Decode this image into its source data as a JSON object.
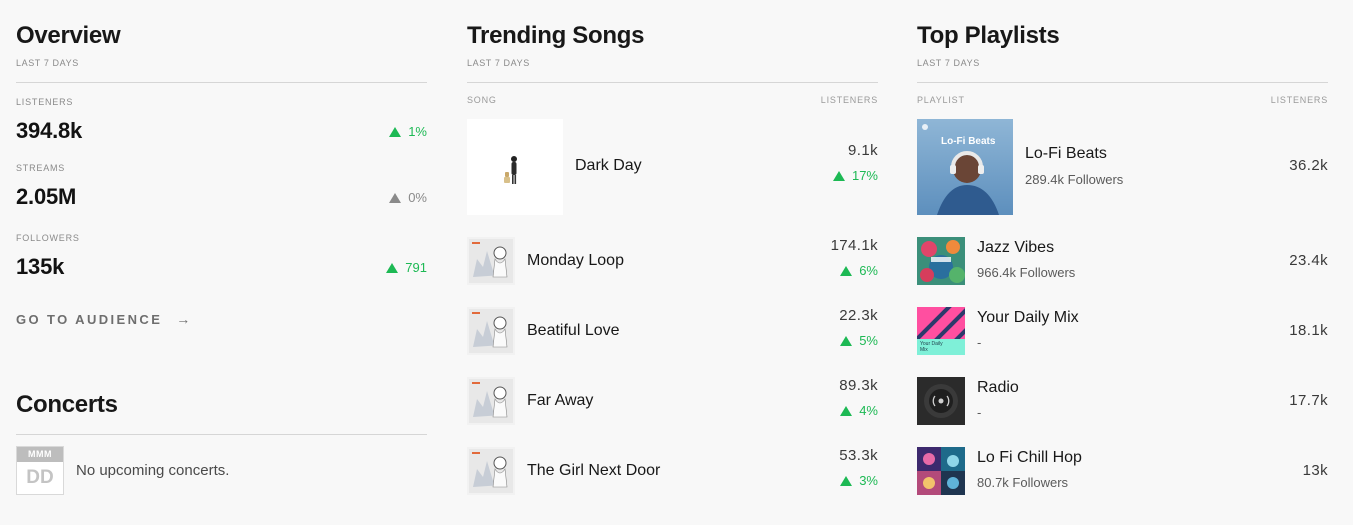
{
  "overview": {
    "title": "Overview",
    "period": "LAST 7 DAYS",
    "stats": [
      {
        "label": "LISTENERS",
        "value": "394.8k",
        "change": "1%",
        "trend": "up"
      },
      {
        "label": "STREAMS",
        "value": "2.05M",
        "change": "0%",
        "trend": "flat"
      },
      {
        "label": "FOLLOWERS",
        "value": "135k",
        "change": "791",
        "trend": "up"
      }
    ],
    "audience_link": "GO TO AUDIENCE",
    "arrow_icon": "arrow-right-icon"
  },
  "concerts": {
    "title": "Concerts",
    "calendar_month": "MMM",
    "calendar_day": "DD",
    "empty_text": "No upcoming concerts."
  },
  "songs": {
    "title": "Trending Songs",
    "period": "LAST 7 DAYS",
    "col_song": "SONG",
    "col_listeners": "LISTENERS",
    "rows": [
      {
        "name": "Dark Day",
        "listeners": "9.1k",
        "change": "17%"
      },
      {
        "name": "Monday Loop",
        "listeners": "174.1k",
        "change": "6%"
      },
      {
        "name": "Beatiful Love",
        "listeners": "22.3k",
        "change": "5%"
      },
      {
        "name": "Far Away",
        "listeners": "89.3k",
        "change": "4%"
      },
      {
        "name": "The Girl Next Door",
        "listeners": "53.3k",
        "change": "3%"
      }
    ]
  },
  "playlists": {
    "title": "Top Playlists",
    "period": "LAST 7 DAYS",
    "col_playlist": "PLAYLIST",
    "col_listeners": "LISTENERS",
    "rows": [
      {
        "name": "Lo-Fi Beats",
        "followers": "289.4k Followers",
        "listeners": "36.2k",
        "cover_text": "Lo-Fi Beats"
      },
      {
        "name": "Jazz Vibes",
        "followers": "966.4k Followers",
        "listeners": "23.4k"
      },
      {
        "name": "Your Daily Mix",
        "followers": "-",
        "listeners": "18.1k",
        "cover_text": "Your Daily Mix"
      },
      {
        "name": "Radio",
        "followers": "-",
        "listeners": "17.7k"
      },
      {
        "name": "Lo Fi Chill Hop",
        "followers": "80.7k Followers",
        "listeners": "13k"
      }
    ]
  },
  "colors": {
    "accent_green": "#1db954",
    "muted_gray": "#8a8a8a"
  }
}
